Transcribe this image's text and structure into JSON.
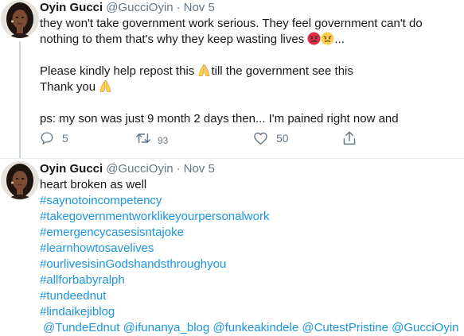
{
  "tweets": [
    {
      "name": "Oyin Gucci",
      "handle": "@GucciOyin",
      "separator": "·",
      "date": "Nov 5",
      "lines": [
        "they won't take government work serious. They feel government can't do",
        "nothing to them that's why they keep wasting lives",
        "...",
        "Please kindly help repost this",
        "till the government see this",
        "Thank you",
        "ps: my son was just 9 month 2 days then... I'm pained right now and"
      ],
      "replies": "5",
      "retweets": "93",
      "likes": "50"
    },
    {
      "name": "Oyin Gucci",
      "handle": "@GucciOyin",
      "separator": "·",
      "date": "Nov 5",
      "text": "heart broken as well",
      "hashtags": [
        "#saynotoincompetency",
        "#takegovernmentworklikeyourpersonalwork",
        "#emergencycasesisntajoke",
        "#learnhowtosavelives",
        "#ourlivesisinGodshandsthroughyou",
        "#allforbabyralph",
        "#tundeednut",
        "#lindaikejiblog"
      ],
      "mentions": "@TundeEdnut @ifunanya_blog @funkeakindele @CutestPristine @GucciOyin"
    }
  ],
  "icons": [
    "reply-icon",
    "retweet-icon",
    "like-icon",
    "share-icon",
    "angry-face-emoji",
    "praying-hands-emoji"
  ],
  "colors": {
    "link": "#1b95e0",
    "muted": "#657786",
    "text": "#14171a",
    "divider": "#e6ecf0"
  }
}
